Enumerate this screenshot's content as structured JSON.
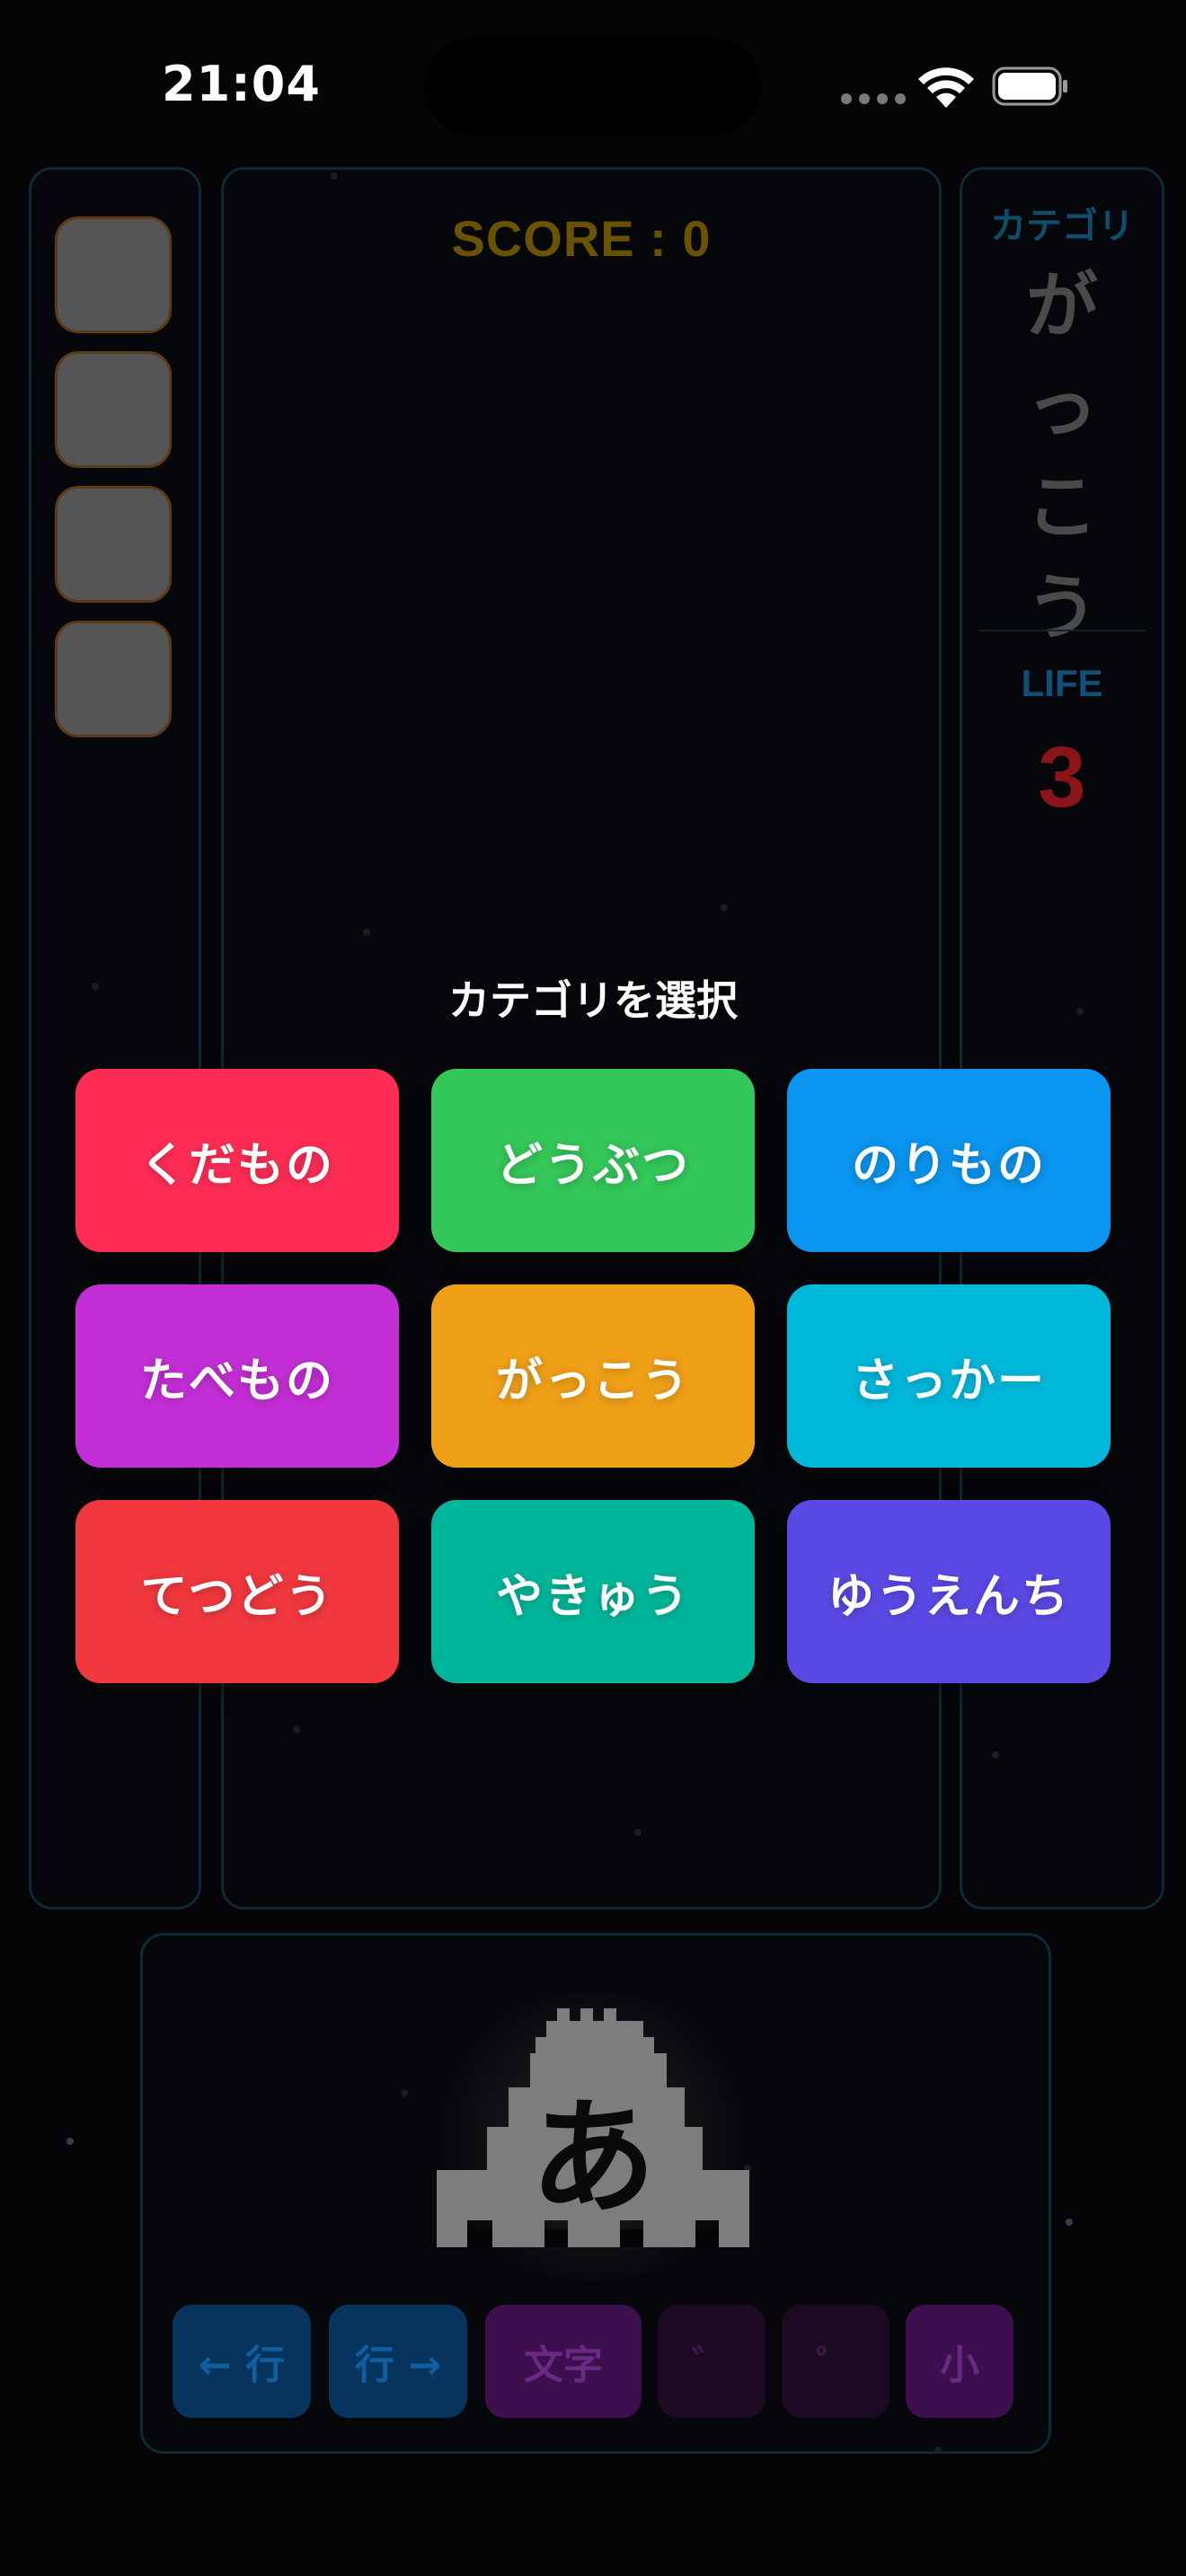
{
  "status_bar": {
    "time": "21:04"
  },
  "game": {
    "score_label": "SCORE :  0",
    "category_label": "カテゴリ",
    "category_value_chars": [
      "が",
      "っ",
      "こ",
      "う"
    ],
    "life_label": "LIFE",
    "life_value": "3"
  },
  "category_modal": {
    "title": "カテゴリを選択",
    "options": [
      {
        "label": "くだもの",
        "color": "#FF2D55"
      },
      {
        "label": "どうぶつ",
        "color": "#34C759"
      },
      {
        "label": "のりもの",
        "color": "#0A95F0"
      },
      {
        "label": "たべもの",
        "color": "#C42ED6"
      },
      {
        "label": "がっこう",
        "color": "#F0A017"
      },
      {
        "label": "さっかー",
        "color": "#00B8DA"
      },
      {
        "label": "てつどう",
        "color": "#F0383E"
      },
      {
        "label": "やきゅう",
        "color": "#00B69A"
      },
      {
        "label": "ゆうえんち",
        "color": "#5B49E6"
      }
    ]
  },
  "controller": {
    "character": "あ",
    "buttons": [
      {
        "label": "← 行",
        "color": "#07345c",
        "text_color": "#0f5fa0"
      },
      {
        "label": "行 →",
        "color": "#07345c",
        "text_color": "#0f5fa0"
      },
      {
        "label": "文字",
        "color": "#3e0f4e",
        "text_color": "#6a2a84"
      },
      {
        "label": "゛",
        "color": "#1c0922",
        "text_color": "#3a1848"
      },
      {
        "label": "゜",
        "color": "#1c0922",
        "text_color": "#3a1848"
      },
      {
        "label": "小",
        "color": "#3e0f4e",
        "text_color": "#6a2a84"
      }
    ]
  }
}
